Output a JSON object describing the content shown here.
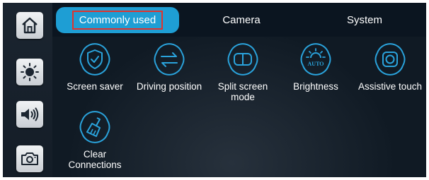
{
  "sidebar": {
    "items": [
      {
        "icon": "home-icon"
      },
      {
        "icon": "brightness-icon"
      },
      {
        "icon": "volume-icon"
      },
      {
        "icon": "camera-icon"
      }
    ]
  },
  "tabs": [
    {
      "label": "Commonly used",
      "active": true
    },
    {
      "label": "Camera",
      "active": false
    },
    {
      "label": "System",
      "active": false
    }
  ],
  "items": [
    {
      "label": "Screen saver",
      "icon": "shield-check-icon"
    },
    {
      "label": "Driving position",
      "icon": "swap-arrows-icon"
    },
    {
      "label": "Split screen mode",
      "icon": "split-screen-icon"
    },
    {
      "label": "Brightness",
      "icon": "auto-brightness-icon",
      "badge": "AUTO"
    },
    {
      "label": "Assistive touch",
      "icon": "assistive-touch-icon"
    },
    {
      "label": "Clear Connections",
      "icon": "broom-icon"
    }
  ],
  "colors": {
    "accent": "#1e9ed4",
    "icon_stroke": "#2aa3dc",
    "highlight_border": "#e0332d",
    "background": "#101a24"
  }
}
